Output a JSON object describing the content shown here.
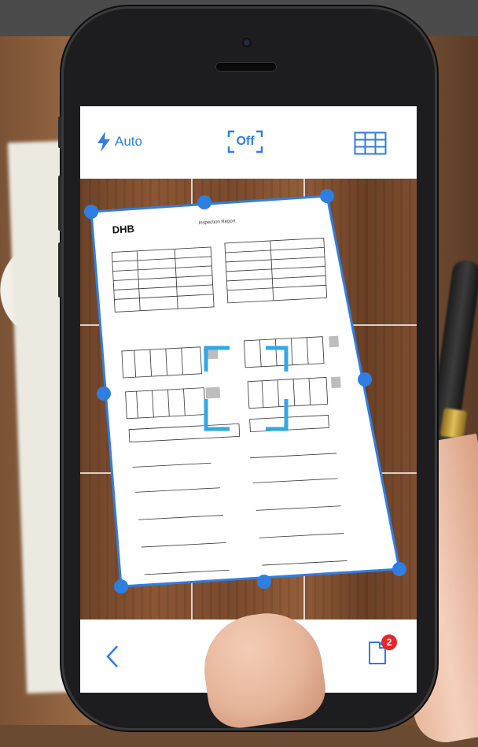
{
  "toolbar": {
    "flash_label": "Auto",
    "perspective_label": "Off",
    "icons": {
      "flash": "lightning-bolt-icon",
      "perspective": "perspective-frame-icon",
      "grid": "grid-view-icon"
    }
  },
  "bottombar": {
    "icons": {
      "back": "chevron-left-icon",
      "shutter": "shutter-button",
      "documents": "document-stack-icon"
    },
    "document_count": "2"
  },
  "document": {
    "logo": "DHB",
    "header": "Inspection Report"
  },
  "colors": {
    "accent": "#2f7ee2",
    "badge": "#e8262b",
    "toolbar_bg": "#ffffff",
    "phone_body": "#1d1d1f"
  }
}
